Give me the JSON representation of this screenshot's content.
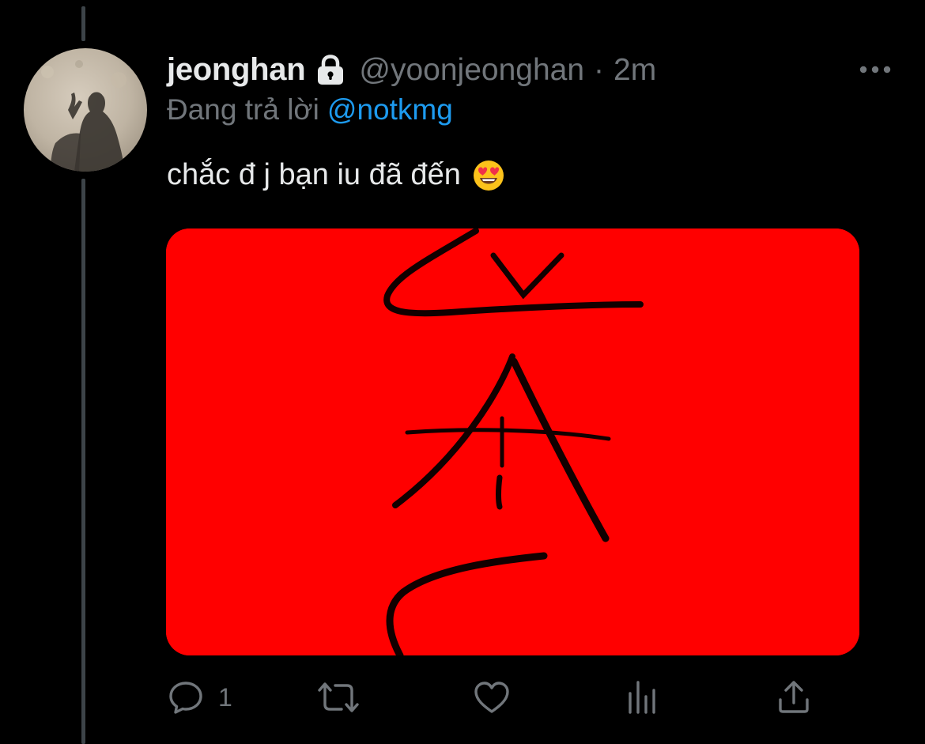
{
  "tweet": {
    "display_name": "jeonghan",
    "handle": "@yoonjeonghan",
    "separator": "·",
    "time": "2m",
    "reply_prefix": "Đang trả lời",
    "reply_to": "@notkmg",
    "text": "chắc đ j bạn iu đã đến",
    "emoji": "smiling-face-with-heart-eyes-icon",
    "media_background": "#ff0000"
  },
  "actions": {
    "reply_count": "1",
    "icons": [
      "reply-icon",
      "retweet-icon",
      "like-icon",
      "analytics-icon",
      "share-icon"
    ]
  },
  "colors": {
    "background": "#000000",
    "primary_text": "#e7e9ea",
    "secondary_text": "#71767b",
    "link": "#1d9bf0",
    "thread_line": "#3d4449"
  }
}
